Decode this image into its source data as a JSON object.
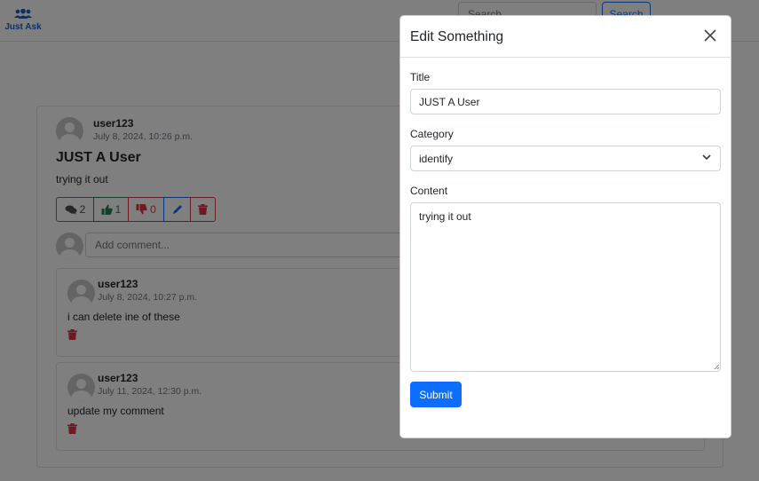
{
  "navbar": {
    "brand_label": "Just Ask",
    "brand_icon": "users-icon",
    "search_placeholder": "Search",
    "search_button": "Search"
  },
  "post": {
    "author": "user123",
    "timestamp": "July 8, 2024, 10:26 p.m.",
    "title": "JUST A User",
    "body": "trying it out",
    "comment_count": "2",
    "like_count": "1",
    "dislike_count": "0",
    "add_comment_placeholder": "Add comment..."
  },
  "comments": [
    {
      "author": "user123",
      "timestamp": "July 8, 2024, 10:27 p.m.",
      "text": "i can delete ine of these"
    },
    {
      "author": "user123",
      "timestamp": "July 11, 2024, 12:30 p.m.",
      "text": "update my comment"
    }
  ],
  "modal": {
    "title": "Edit Something",
    "title_label": "Title",
    "title_value": "JUST A User",
    "category_label": "Category",
    "category_value": "identify",
    "content_label": "Content",
    "content_value": "trying it out",
    "submit_label": "Submit"
  },
  "colors": {
    "primary": "#0d6efd",
    "success": "#198754",
    "danger": "#dc3545",
    "brand": "#1f5fc4"
  }
}
